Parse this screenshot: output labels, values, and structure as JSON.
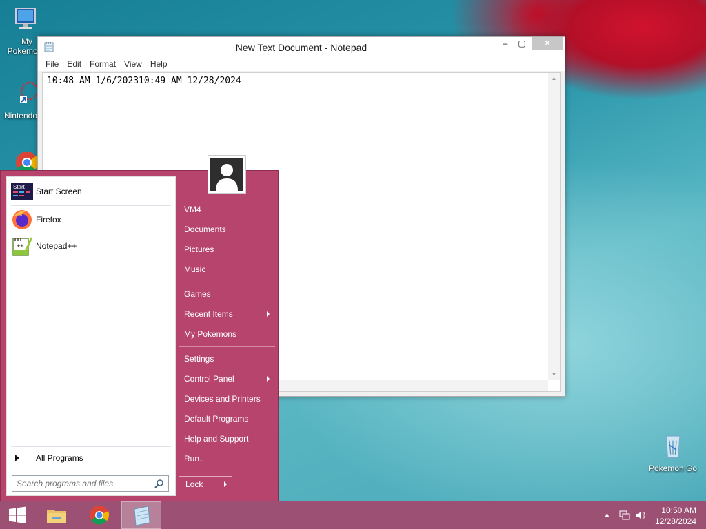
{
  "desktop": {
    "icons": [
      {
        "label": "My Pokemons"
      },
      {
        "label": "Nintendo"
      },
      {
        "label": "Google Chrome"
      },
      {
        "label": "Pokemon Go"
      }
    ]
  },
  "notepad": {
    "title": "New Text Document - Notepad",
    "menu": [
      "File",
      "Edit",
      "Format",
      "View",
      "Help"
    ],
    "content": "10:48 AM 1/6/202310:49 AM 12/28/2024",
    "buttons": {
      "minimize": "‒",
      "maximize": "▢",
      "close": "✕"
    }
  },
  "start_menu": {
    "pinned": [
      {
        "label": "Start Screen",
        "icon": "start-screen-icon"
      },
      {
        "label": "Firefox",
        "icon": "firefox-icon"
      },
      {
        "label": "Notepad++",
        "icon": "notepad-plus-plus-icon"
      }
    ],
    "all_programs": "All Programs",
    "search_placeholder": "Search programs and files",
    "right_items": [
      {
        "label": "VM4"
      },
      {
        "label": "Documents"
      },
      {
        "label": "Pictures"
      },
      {
        "label": "Music"
      },
      {
        "label": "Games"
      },
      {
        "label": "Recent Items",
        "submenu": true
      },
      {
        "label": "My Pokemons"
      },
      {
        "label": "Settings"
      },
      {
        "label": "Control Panel",
        "submenu": true
      },
      {
        "label": "Devices and Printers"
      },
      {
        "label": "Default Programs"
      },
      {
        "label": "Help and Support"
      },
      {
        "label": "Run..."
      }
    ],
    "lock_label": "Lock",
    "start_screen_badge": "Start"
  },
  "taskbar": {
    "items": [
      "Start",
      "File Explorer",
      "Google Chrome",
      "Notepad"
    ],
    "clock_time": "10:50 AM",
    "clock_date": "12/28/2024",
    "tray_icons": [
      "show-hidden-icons",
      "network-icon",
      "volume-icon"
    ]
  },
  "colors": {
    "start_menu_bg": "#b6446c",
    "taskbar_bg": "#9c5174"
  }
}
